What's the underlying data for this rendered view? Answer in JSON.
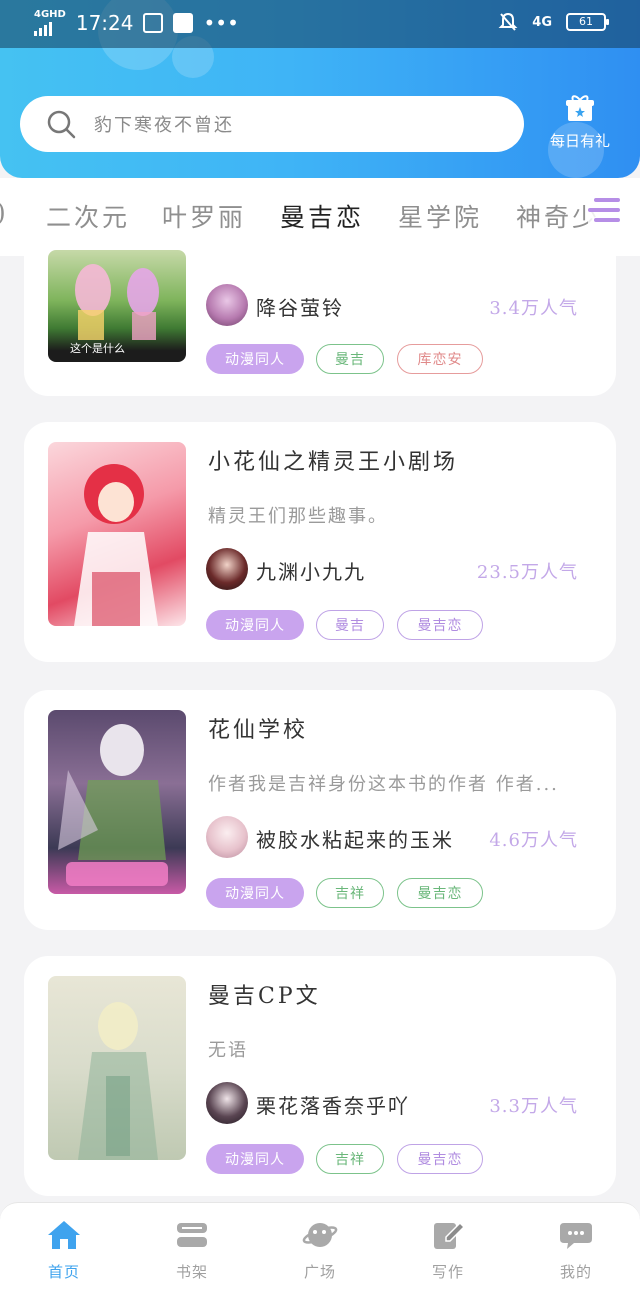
{
  "status_bar": {
    "network": "4GHD",
    "time": "17:24",
    "dots": "•••",
    "network_right": "4G",
    "battery": "61"
  },
  "header": {
    "search_placeholder": "豹下寒夜不曾还",
    "gift_label": "每日有礼"
  },
  "tabs": [
    {
      "label": "二次元"
    },
    {
      "label": "叶罗丽"
    },
    {
      "label": "曼吉恋"
    },
    {
      "label": "星学院"
    },
    {
      "label": "神奇少"
    }
  ],
  "cards": [
    {
      "cover_caption": "这个是什么",
      "author": "降谷萤铃",
      "popularity": "3.4万人气",
      "tags": [
        "动漫同人",
        "曼吉",
        "库恋安"
      ]
    },
    {
      "title": "小花仙之精灵王小剧场",
      "description": "精灵王们那些趣事。",
      "author": "九渊小九九",
      "popularity": "23.5万人气",
      "tags": [
        "动漫同人",
        "曼吉",
        "曼吉恋"
      ]
    },
    {
      "title": "花仙学校",
      "description": "作者我是吉祥身份这本书的作者 作者...",
      "author": "被胶水粘起来的玉米",
      "popularity": "4.6万人气",
      "tags": [
        "动漫同人",
        "吉祥",
        "曼吉恋"
      ]
    },
    {
      "title": "曼吉CP文",
      "description": "无语",
      "author": "栗花落香奈乎吖",
      "popularity": "3.3万人气",
      "tags": [
        "动漫同人",
        "吉祥",
        "曼吉恋"
      ]
    }
  ],
  "bottom_nav": [
    {
      "label": "首页",
      "icon": "home-icon",
      "active": true
    },
    {
      "label": "书架",
      "icon": "bookshelf-icon"
    },
    {
      "label": "广场",
      "icon": "planet-icon"
    },
    {
      "label": "写作",
      "icon": "pen-icon"
    },
    {
      "label": "我的",
      "icon": "chat-icon"
    }
  ],
  "colors": {
    "accent": "#3fa3ee",
    "tag_primary": "#c9a4ee",
    "popularity": "#c3a8e8",
    "tab_underline": "#b69ae6"
  }
}
